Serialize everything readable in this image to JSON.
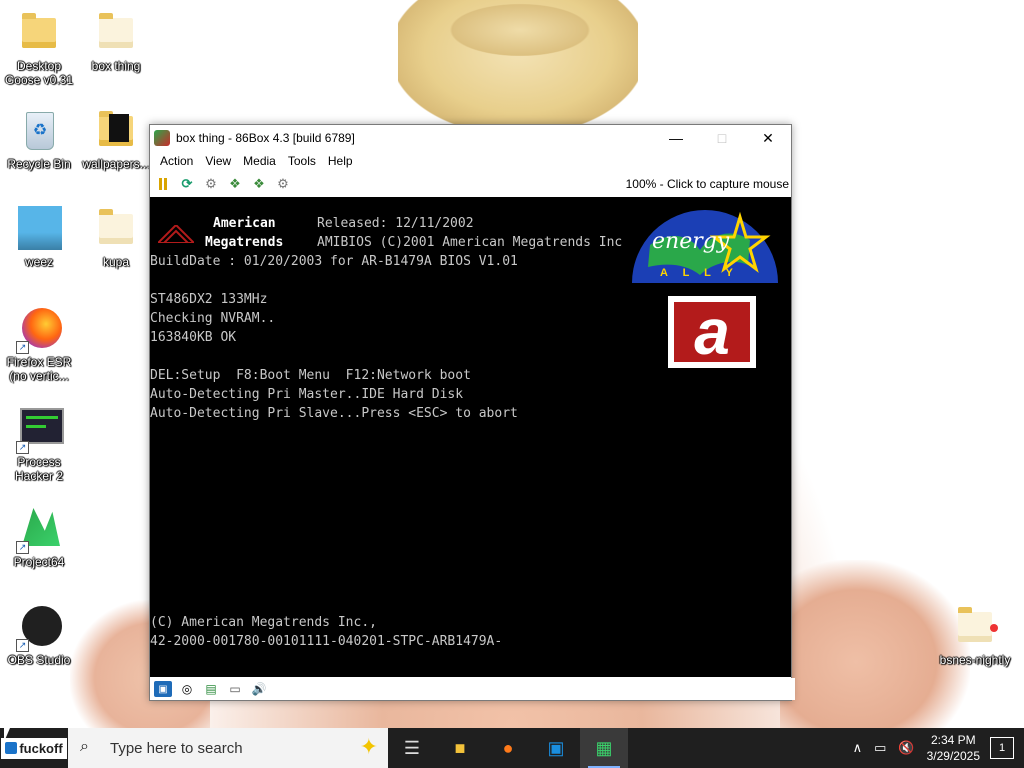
{
  "desktop": {
    "icons": [
      {
        "label": "Desktop Goose v0.31"
      },
      {
        "label": "box thing"
      },
      {
        "label": "Recycle Bin"
      },
      {
        "label": "wallpapers..."
      },
      {
        "label": "weez"
      },
      {
        "label": "kupa"
      },
      {
        "label": "Firefox ESR (no vertic..."
      },
      {
        "label": "Process Hacker 2"
      },
      {
        "label": "Project64"
      },
      {
        "label": "OBS Studio"
      },
      {
        "label": "bsnes-nightly"
      }
    ]
  },
  "window": {
    "title": "box thing - 86Box 4.3 [build 6789]",
    "menu": [
      "Action",
      "View",
      "Media",
      "Tools",
      "Help"
    ],
    "status_text": "100% - Click to capture mouse"
  },
  "bios": {
    "header_left_1": "American",
    "header_left_2": "Megatrends",
    "released": "Released: 12/11/2002",
    "copyright_line": "AMIBIOS (C)2001 American Megatrends Inc",
    "build_date": "BuildDate : 01/20/2003 for AR-B1479A BIOS V1.01",
    "cpu": "ST486DX2 133MHz",
    "nvram": "Checking NVRAM..",
    "memory": "163840KB OK",
    "keys": "DEL:Setup  F8:Boot Menu  F12:Network boot",
    "detect_master": "Auto-Detecting Pri Master..IDE Hard Disk",
    "detect_slave": "Auto-Detecting Pri Slave...Press <ESC> to abort",
    "footer_1": "(C) American Megatrends Inc.,",
    "footer_2": "42-2000-001780-00101111-040201-STPC-ARB1479A-",
    "energy_word": "energy",
    "energy_ally": "A L L Y",
    "logo_letter": "a"
  },
  "taskbar": {
    "start_label": "fuckoff",
    "search_placeholder": "Type here to search",
    "time": "2:34 PM",
    "date": "3/29/2025",
    "notification_count": "1"
  },
  "colors": {
    "taskbar_bg": "#1f1f1f",
    "bios_bg": "#000000",
    "bios_text": "#c8c8c8",
    "ami_red": "#b31b1b"
  }
}
